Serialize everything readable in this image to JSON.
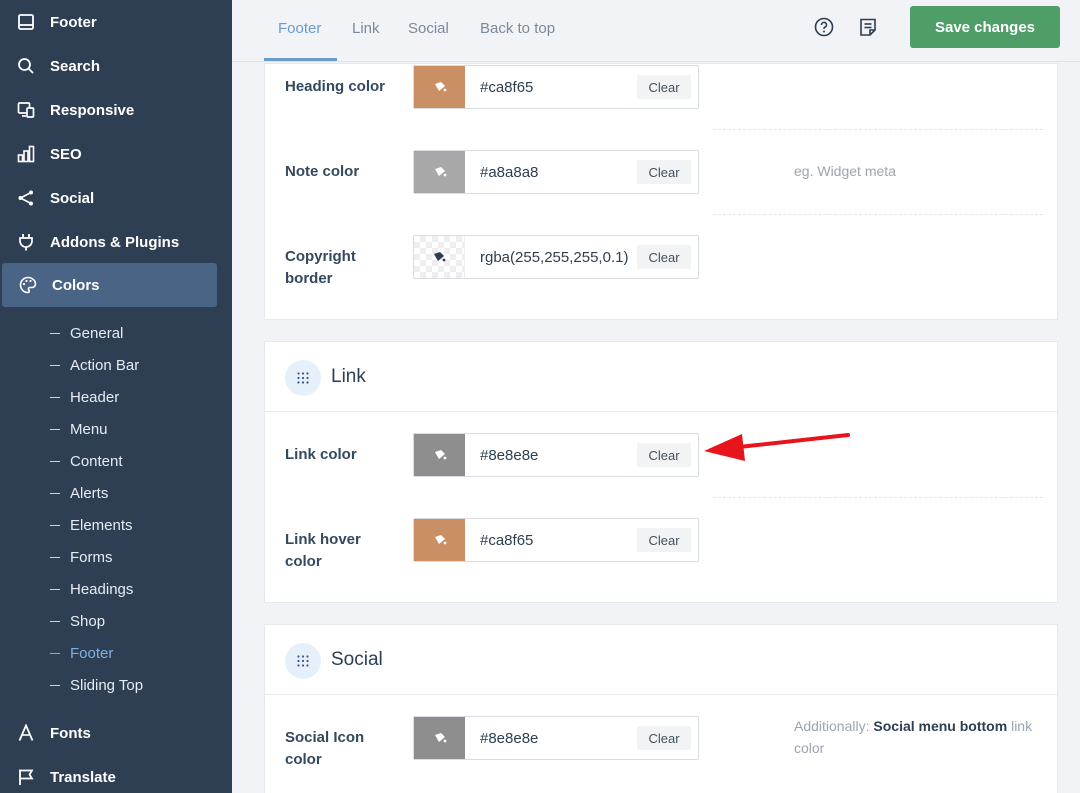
{
  "sidebar": {
    "items": [
      {
        "label": "Footer",
        "icon": "footer-icon"
      },
      {
        "label": "Search",
        "icon": "search-icon"
      },
      {
        "label": "Responsive",
        "icon": "responsive-icon"
      },
      {
        "label": "SEO",
        "icon": "chart-bars-icon"
      },
      {
        "label": "Social",
        "icon": "share-icon"
      },
      {
        "label": "Addons & Plugins",
        "icon": "plug-icon"
      },
      {
        "label": "Colors",
        "icon": "palette-icon"
      },
      {
        "label": "Fonts",
        "icon": "font-icon"
      },
      {
        "label": "Translate",
        "icon": "flag-icon"
      }
    ],
    "color_subitems": [
      "General",
      "Action Bar",
      "Header",
      "Menu",
      "Content",
      "Alerts",
      "Elements",
      "Forms",
      "Headings",
      "Shop",
      "Footer",
      "Sliding Top"
    ],
    "active_subitem": "Footer"
  },
  "topbar": {
    "tabs": [
      "Footer",
      "Link",
      "Social",
      "Back to top"
    ],
    "active_tab": "Footer",
    "help_icon": "help-circle-icon",
    "notes_icon": "notes-icon",
    "save_label": "Save changes"
  },
  "footer_section": {
    "rows": [
      {
        "label": "Heading color",
        "value": "#ca8f65",
        "swatch": "#ca8f65",
        "clear": "Clear",
        "note": ""
      },
      {
        "label": "Note color",
        "value": "#a8a8a8",
        "swatch": "#a8a8a8",
        "clear": "Clear",
        "note": "eg. Widget meta"
      },
      {
        "label": "Copyright border",
        "value": "rgba(255,255,255,0.1)",
        "swatch": "transparent",
        "clear": "Clear",
        "note": ""
      }
    ]
  },
  "link_section": {
    "title": "Link",
    "rows": [
      {
        "label": "Link color",
        "value": "#8e8e8e",
        "swatch": "#8e8e8e",
        "clear": "Clear"
      },
      {
        "label": "Link hover color",
        "value": "#ca8f65",
        "swatch": "#ca8f65",
        "clear": "Clear"
      }
    ]
  },
  "social_section": {
    "title": "Social",
    "rows": [
      {
        "label": "Social Icon color",
        "value": "#8e8e8e",
        "swatch": "#8e8e8e",
        "clear": "Clear",
        "note_prefix": "Additionally:",
        "note_bold": "Social menu bottom",
        "note_link": "link",
        "note_suffix": "color"
      }
    ]
  },
  "colors": {
    "sidebar_bg": "#2e3f53",
    "sidebar_active": "#4a6486",
    "accent": "#6a9cd0",
    "save_button": "#4f9e68",
    "annotation_arrow": "#e8141b"
  }
}
